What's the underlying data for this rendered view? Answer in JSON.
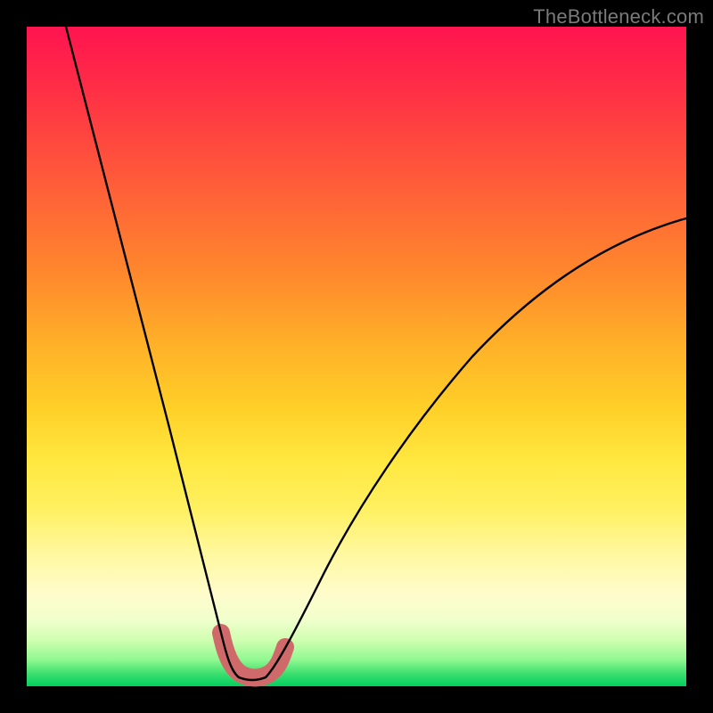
{
  "watermark": "TheBottleneck.com",
  "colors": {
    "background": "#000000",
    "gradient_top": "#ff1450",
    "gradient_mid": "#ffe840",
    "gradient_bottom": "#00d060",
    "curve": "#000000",
    "valley_marker": "#d06a6a"
  },
  "chart_data": {
    "type": "line",
    "title": "",
    "xlabel": "",
    "ylabel": "",
    "xlim": [
      0,
      100
    ],
    "ylim": [
      0,
      100
    ],
    "series": [
      {
        "name": "left-branch",
        "x": [
          6,
          10,
          14,
          18,
          22,
          25,
          27,
          29,
          30.5,
          31.5
        ],
        "y": [
          100,
          78,
          58,
          40,
          25,
          14,
          8,
          3.5,
          1.5,
          0.8
        ]
      },
      {
        "name": "right-branch",
        "x": [
          36,
          38,
          41,
          46,
          53,
          62,
          72,
          82,
          92,
          100
        ],
        "y": [
          0.8,
          2.5,
          6,
          12,
          20,
          30,
          41,
          52,
          62,
          70
        ]
      },
      {
        "name": "valley-floor",
        "x": [
          31.5,
          33,
          34.5,
          36
        ],
        "y": [
          0.8,
          0.4,
          0.4,
          0.8
        ]
      }
    ],
    "annotations": [
      {
        "name": "valley-marker",
        "shape": "rounded-U",
        "x_range": [
          29.5,
          38
        ],
        "y_range": [
          0,
          8
        ],
        "color": "#d06a6a"
      }
    ]
  }
}
